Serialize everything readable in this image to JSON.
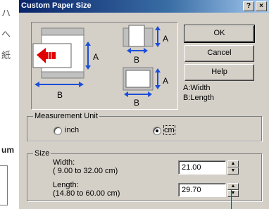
{
  "background": {
    "text_1": "ハ",
    "text_2": "へ",
    "text_3": "紙",
    "text_4": "um"
  },
  "dialog": {
    "title": "Custom Paper Size",
    "help_glyph": "?",
    "close_glyph": "×",
    "buttons": {
      "ok": "OK",
      "cancel": "Cancel",
      "help": "Help"
    },
    "legend": {
      "width": "A:Width",
      "length": "B:Length"
    },
    "preview_labels": {
      "a": "A",
      "b": "B"
    },
    "measurement": {
      "label": "Measurement Unit",
      "options": [
        "inch",
        "cm"
      ],
      "selected": "cm"
    },
    "size": {
      "label": "Size",
      "width_label": "Width:",
      "width_range": "( 9.00 to 32.00 cm)",
      "width_value": "21.00",
      "length_label": "Length:",
      "length_range": "(14.80 to 60.00 cm)",
      "length_value": "29.70"
    }
  },
  "colors": {
    "titlebar_start": "#0a246a",
    "titlebar_end": "#a6caf0",
    "dialog_bg": "#d4d0c8",
    "arrow_blue": "#1c4ed8",
    "arrow_red": "#e00000"
  }
}
